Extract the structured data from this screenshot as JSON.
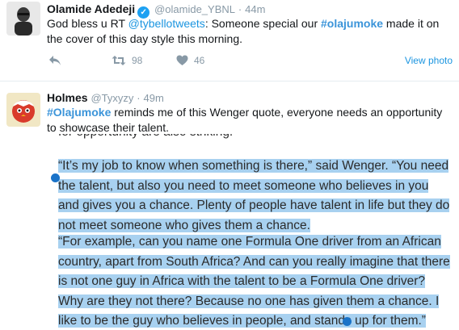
{
  "tweets": [
    {
      "name": "Olamide Adedeji",
      "verified": true,
      "handle": "@olamide_YBNL",
      "dot": "·",
      "time": "44m",
      "text_1": "God bless u RT ",
      "mention": "@tybellotweets",
      "text_2": ": Someone special our ",
      "hashtag": "#olajumoke",
      "text_3": " made it on the cover of this day style this morning.",
      "retweets": "98",
      "likes": "46",
      "view_photo": "View photo",
      "icons": {
        "reply": "reply-icon",
        "retweet": "retweet-icon",
        "like": "heart-icon"
      }
    },
    {
      "name": "Holmes",
      "handle": "@Tyxyzy",
      "dot": "·",
      "time": "49m",
      "hashtag": "#Olajumoke",
      "text": " reminds me of this Wenger quote, everyone needs an opportunity to showcase their talent."
    }
  ],
  "article": {
    "cut_line": "for opportunity are also striking.",
    "paragraph_1": "“It’s my job to know when something is there,” said Wenger. “You need the talent, but also you need to meet someone who believes in you and gives you a chance. Plenty of people have talent in life but they do not meet someone who gives them a chance.",
    "paragraph_2": "“For example, can you name one Formula One driver from an African country, apart from South Africa? And can you really imagine that there is not one guy in Africa with the talent to be a Formula One driver? Why are they not there? Because no one has given them a chance. I like to be the guy who believes in people, and stands up for them.”",
    "highlight_color": "#a8d1f0",
    "selection_handle_color": "#1a73c8"
  }
}
